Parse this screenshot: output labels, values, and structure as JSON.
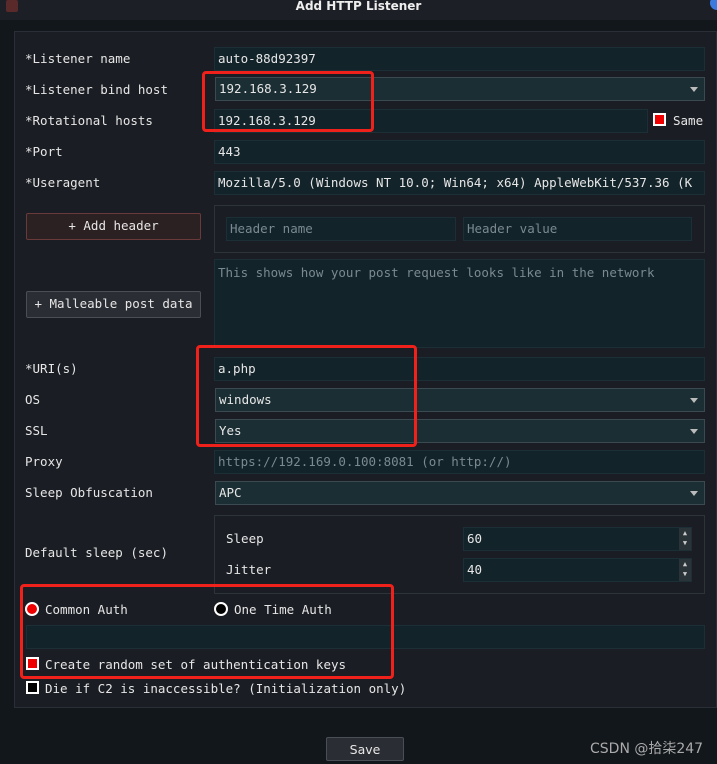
{
  "window": {
    "title": "Add HTTP Listener"
  },
  "form": {
    "listener_name": {
      "label": "*Listener name",
      "value": "auto-88d92397"
    },
    "bind_host": {
      "label": "*Listener bind host",
      "value": "192.168.3.129"
    },
    "rotational_hosts": {
      "label": "*Rotational hosts",
      "value": "192.168.3.129",
      "same_label": "Same",
      "same_checked": true
    },
    "port": {
      "label": "*Port",
      "value": "443"
    },
    "useragent": {
      "label": "*Useragent",
      "value": "Mozilla/5.0 (Windows NT 10.0; Win64; x64) AppleWebKit/537.36 (K"
    },
    "add_header_label": "+ Add header",
    "header_name_placeholder": "Header name",
    "header_value_placeholder": "Header value",
    "malleable_label": "+ Malleable post data",
    "post_data_placeholder": "This shows how your post request looks like in the network",
    "uris": {
      "label": "*URI(s)",
      "value": "a.php"
    },
    "os": {
      "label": "OS",
      "value": "windows"
    },
    "ssl": {
      "label": "SSL",
      "value": "Yes"
    },
    "proxy": {
      "label": "Proxy",
      "placeholder": "https://192.169.0.100:8081 (or http://)"
    },
    "sleep_obfuscation": {
      "label": "Sleep Obfuscation",
      "value": "APC"
    },
    "default_sleep": {
      "label": "Default sleep (sec)",
      "sleep_label": "Sleep",
      "sleep_value": "60",
      "jitter_label": "Jitter",
      "jitter_value": "40"
    },
    "auth": {
      "common_label": "Common Auth",
      "common_selected": true,
      "one_time_label": "One Time Auth",
      "one_time_selected": false,
      "value": ""
    },
    "random_keys": {
      "label": "Create random set of authentication keys",
      "checked": true
    },
    "die_if_inaccessible": {
      "label": "Die if C2 is inaccessible? (Initialization only)",
      "checked": false
    },
    "save_label": "Save"
  },
  "watermark": "CSDN @拾柒247",
  "colors": {
    "accent": "#e00000",
    "annotation": "#f0201a"
  }
}
